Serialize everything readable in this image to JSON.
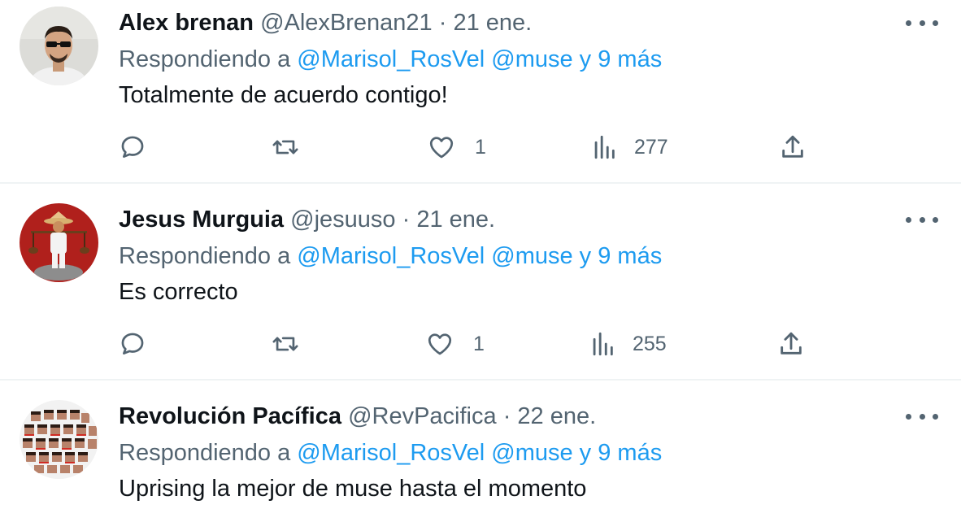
{
  "tweets": [
    {
      "name": "Alex brenan",
      "handle": "@AlexBrenan21",
      "separator": "·",
      "time": "21 ene.",
      "reply_prefix": "Respondiendo a",
      "reply_targets": "@Marisol_RosVel @muse y 9 más",
      "text": "Totalmente de acuerdo contigo!",
      "likes": "1",
      "views": "277"
    },
    {
      "name": "Jesus Murguia",
      "handle": "@jesuuso",
      "separator": "·",
      "time": "21 ene.",
      "reply_prefix": "Respondiendo a",
      "reply_targets": "@Marisol_RosVel @muse y 9 más",
      "text": "Es correcto",
      "likes": "1",
      "views": "255"
    },
    {
      "name": "Revolución Pacífica",
      "handle": "@RevPacifica",
      "separator": "·",
      "time": "22 ene.",
      "reply_prefix": "Respondiendo a",
      "reply_targets": "@Marisol_RosVel @muse y 9 más",
      "text": "Uprising la mejor de muse hasta el momento"
    }
  ],
  "icons": {
    "reply": "reply-icon",
    "retweet": "retweet-icon",
    "like": "heart-icon",
    "views": "views-icon",
    "share": "share-icon",
    "more": "more-icon"
  },
  "colors": {
    "link": "#1d9bf0",
    "secondary_text": "#536471",
    "primary_text": "#0f1419",
    "divider": "#eff3f4"
  }
}
